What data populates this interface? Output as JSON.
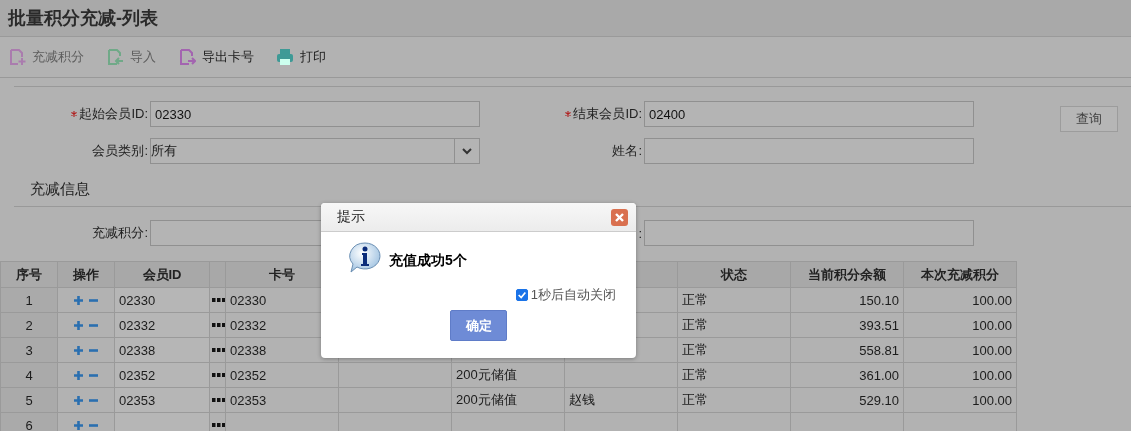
{
  "page": {
    "title": "批量积分充减-列表"
  },
  "toolbar": [
    {
      "kind": "add",
      "label": "充减积分",
      "disabled": true
    },
    {
      "kind": "import",
      "label": "导入",
      "disabled": true
    },
    {
      "kind": "export",
      "label": "导出卡号",
      "disabled": false
    },
    {
      "kind": "print",
      "label": "打印",
      "disabled": false
    }
  ],
  "query_form": {
    "fields": [
      {
        "label": "起始会员ID:",
        "required": true,
        "value": "02330",
        "kind": "text"
      },
      {
        "label": "结束会员ID:",
        "required": true,
        "value": "02400",
        "kind": "text"
      },
      {
        "label": "会员类别:",
        "required": false,
        "value": "所有",
        "kind": "select"
      },
      {
        "label": "姓名:",
        "required": false,
        "kind": "text"
      }
    ],
    "search_button": "查询"
  },
  "adjust_section": {
    "heading": "充减信息",
    "fields": [
      {
        "label": "充减积分:",
        "required": false,
        "kind": "text"
      },
      {
        "label": ":",
        "required": false,
        "kind": "text"
      }
    ]
  },
  "table": {
    "columns": [
      {
        "label": "序号"
      },
      {
        "label": "操作"
      },
      {
        "label": "会员ID"
      },
      {},
      {
        "label": "卡号"
      },
      {},
      {},
      {},
      {
        "label": "状态"
      },
      {
        "label": "当前积分余额"
      },
      {
        "label": "本次充减积分"
      }
    ],
    "rows": [
      {
        "index": "1",
        "member_id": "02330",
        "card_no": "02330",
        "status": "正常",
        "balance": "150.10",
        "amount": "100.00"
      },
      {
        "index": "2",
        "member_id": "02332",
        "card_no": "02332",
        "status": "正常",
        "balance": "393.51",
        "amount": "100.00"
      },
      {
        "index": "3",
        "member_id": "02338",
        "card_no": "02338",
        "status": "正常",
        "balance": "558.81",
        "amount": "100.00"
      },
      {
        "index": "4",
        "member_id": "02352",
        "card_no": "02352",
        "column_6": "200元储值",
        "status": "正常",
        "balance": "361.00",
        "amount": "100.00"
      },
      {
        "index": "5",
        "member_id": "02353",
        "card_no": "02353",
        "column_6": "200元储值",
        "column_7": "赵钱",
        "status": "正常",
        "balance": "529.10",
        "amount": "100.00"
      },
      {
        "index": "6"
      }
    ]
  },
  "dialog": {
    "title": "提示",
    "message": "充值成功5个",
    "auto_close": {
      "label": "1秒后自动关闭",
      "checked": true
    },
    "button": "确定"
  }
}
